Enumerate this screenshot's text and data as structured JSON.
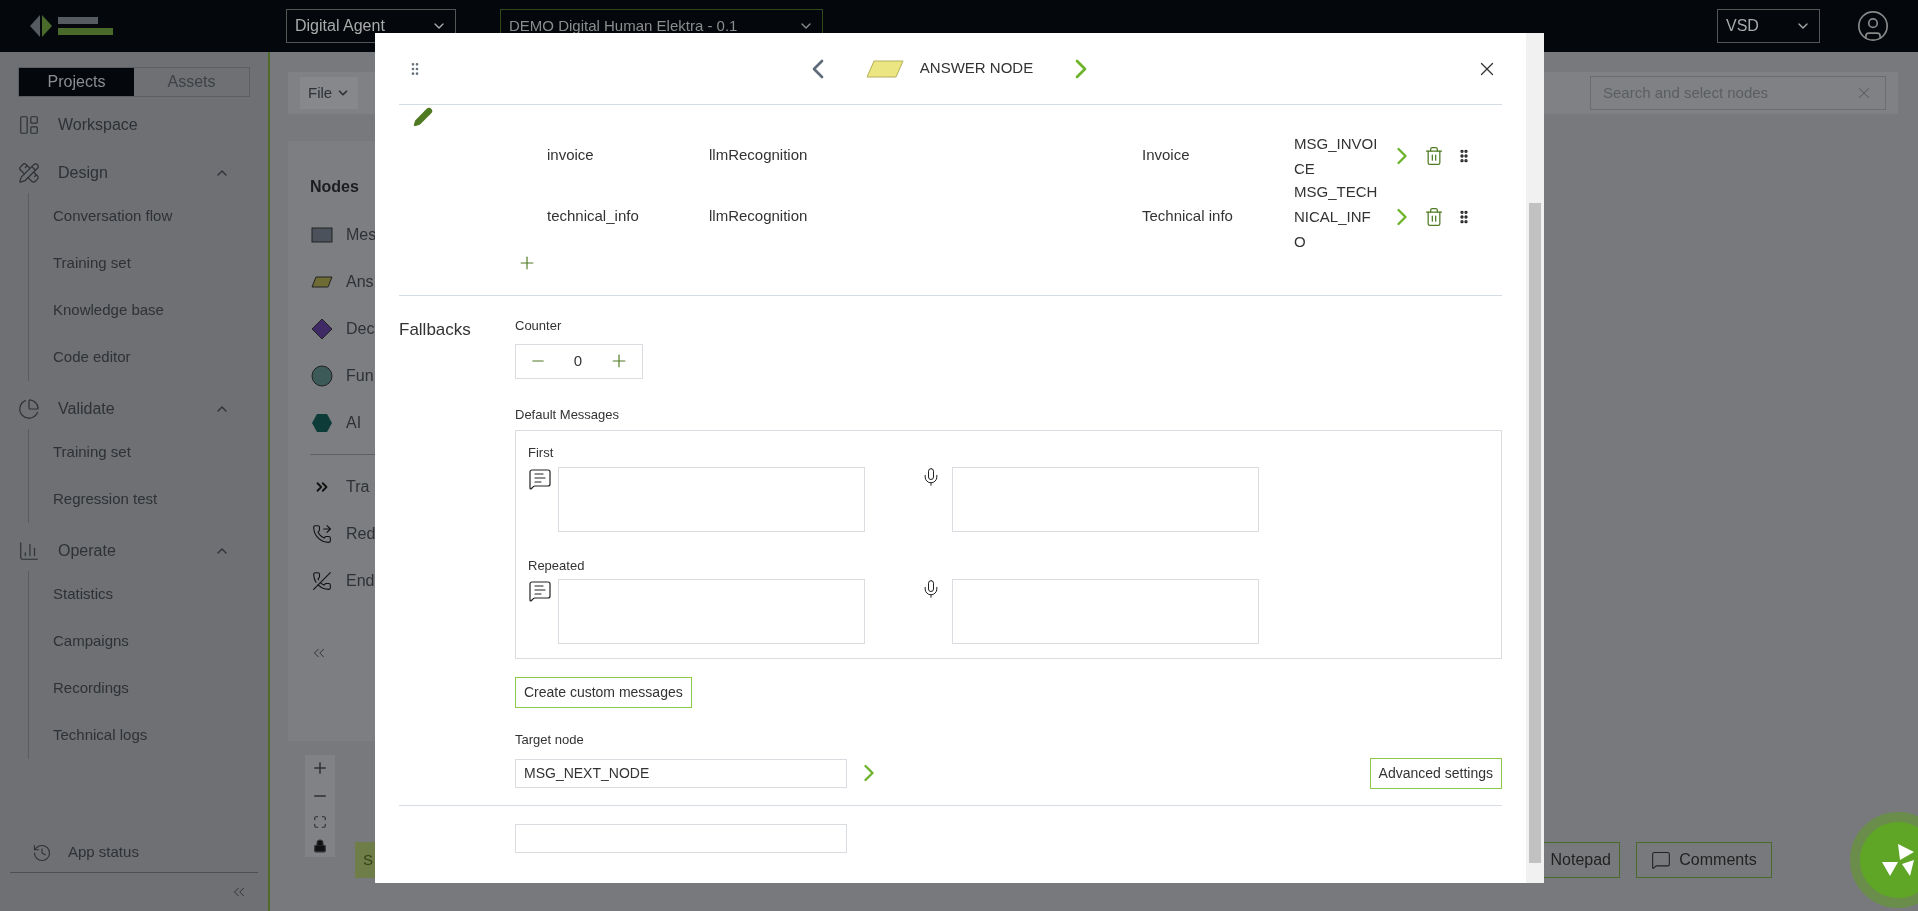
{
  "header": {
    "agent_select": "Digital Agent",
    "project_select": "DEMO Digital Human Elektra - 0.1",
    "language_select": "VSD"
  },
  "sidebar": {
    "tabs": [
      {
        "label": "Projects",
        "selected": true
      },
      {
        "label": "Assets",
        "selected": false
      }
    ],
    "sections": [
      {
        "label": "Workspace",
        "kind": "workspace"
      },
      {
        "label": "Design",
        "kind": "design",
        "expanded": true,
        "children": [
          {
            "label": "Conversation flow"
          },
          {
            "label": "Training set"
          },
          {
            "label": "Knowledge base"
          },
          {
            "label": "Code editor"
          }
        ]
      },
      {
        "label": "Validate",
        "kind": "validate",
        "expanded": true,
        "children": [
          {
            "label": "Training set"
          },
          {
            "label": "Regression test"
          }
        ]
      },
      {
        "label": "Operate",
        "kind": "operate",
        "expanded": true,
        "children": [
          {
            "label": "Statistics"
          },
          {
            "label": "Campaigns"
          },
          {
            "label": "Recordings"
          },
          {
            "label": "Technical logs"
          }
        ]
      }
    ],
    "footer": "App status"
  },
  "canvas": {
    "file_menu": "File",
    "search_placeholder": "Search and select nodes",
    "nodes_title": "Nodes",
    "nodes": [
      {
        "label": "Mes",
        "kind": "message"
      },
      {
        "label": "Ans",
        "kind": "answer"
      },
      {
        "label": "Dec",
        "kind": "decision"
      },
      {
        "label": "Fun",
        "kind": "function"
      },
      {
        "label": "AI",
        "kind": "ai"
      },
      {
        "label": "Tra",
        "kind": "transfer"
      },
      {
        "label": "Red",
        "kind": "redirect"
      },
      {
        "label": "End",
        "kind": "end"
      }
    ],
    "save_button": "S",
    "notepad": "Notepad",
    "comments": "Comments"
  },
  "modal": {
    "title": "ANSWER NODE",
    "intents": [
      {
        "name": "invoice",
        "method": "llmRecognition",
        "label": "Invoice",
        "target": "MSG_INVOICE"
      },
      {
        "name": "technical_info",
        "method": "llmRecognition",
        "label": "Technical info",
        "target": "MSG_TECHNICAL_INFO"
      }
    ],
    "fallbacks": {
      "title": "Fallbacks",
      "counter_label": "Counter",
      "counter": "0",
      "default_messages_label": "Default Messages",
      "messages": [
        {
          "label": "First"
        },
        {
          "label": "Repeated"
        }
      ],
      "custom_button": "Create custom messages",
      "target_label": "Target node",
      "target_value": "MSG_NEXT_NODE",
      "advanced_button": "Advanced settings"
    }
  }
}
